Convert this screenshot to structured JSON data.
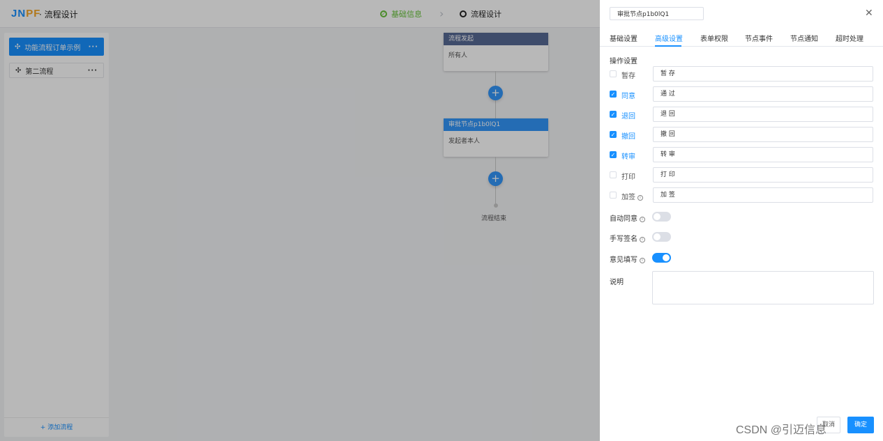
{
  "app": {
    "logo_part1": "JN",
    "logo_part2": "PF",
    "title": "· 流程设计"
  },
  "steps": [
    {
      "label": "基础信息",
      "icon": "check-circle-icon"
    },
    {
      "label": "流程设计",
      "icon": "circle-icon"
    }
  ],
  "sidebar": {
    "items": [
      {
        "label": "功能流程订单示例"
      },
      {
        "label": "第二流程"
      }
    ],
    "add_label": "+ 添加流程"
  },
  "canvas": {
    "start_node": {
      "title": "流程发起",
      "body": "所有人"
    },
    "approve_node": {
      "title": "审批节点p1b0lQ1",
      "body": "发起者本人"
    },
    "end_label": "流程结束"
  },
  "drawer": {
    "node_name": "审批节点p1b0lQ1",
    "tabs": [
      "基础设置",
      "高级设置",
      "表单权限",
      "节点事件",
      "节点通知",
      "超时处理"
    ],
    "active_tab": "高级设置",
    "section_title": "操作设置",
    "operations": [
      {
        "label": "暂存",
        "value": "暂 存",
        "checked": false
      },
      {
        "label": "同意",
        "value": "通 过",
        "checked": true
      },
      {
        "label": "退回",
        "value": "退 回",
        "checked": true
      },
      {
        "label": "撤回",
        "value": "撤 回",
        "checked": true
      },
      {
        "label": "转审",
        "value": "转 审",
        "checked": true
      },
      {
        "label": "打印",
        "value": "打 印",
        "checked": false
      },
      {
        "label": "加签",
        "value": "加 签",
        "checked": false
      }
    ],
    "switches": [
      {
        "label": "自动同意",
        "on": false
      },
      {
        "label": "手写签名",
        "on": false
      },
      {
        "label": "意见填写",
        "on": true
      }
    ],
    "desc_label": "说明",
    "cancel_label": "取消",
    "ok_label": "确定"
  },
  "watermark": "CSDN @引迈信息",
  "colors": {
    "accent": "#1890ff",
    "success": "#67c23a",
    "start_node": "#576a95",
    "approve_node": "#3296fa"
  }
}
